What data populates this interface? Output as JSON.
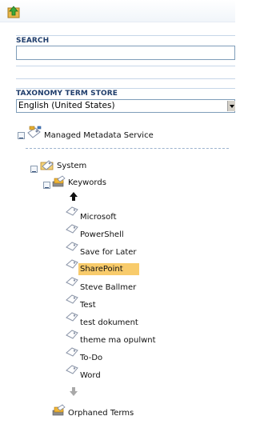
{
  "search": {
    "label": "SEARCH",
    "value": ""
  },
  "store": {
    "label": "TAXONOMY TERM STORE",
    "selected_language": "English (United States)"
  },
  "tree": {
    "service": "Managed Metadata Service",
    "group": "System",
    "term_set": "Keywords",
    "terms": [
      "Microsoft",
      "PowerShell",
      "Save for Later",
      "SharePoint",
      "Steve Ballmer",
      "Test",
      "test dokument",
      "theme ma opulwnt",
      "To-Do",
      "Word"
    ],
    "selected_term": "SharePoint",
    "orphaned": "Orphaned Terms"
  },
  "colors": {
    "accent": "#1f3d6b",
    "highlight": "#f8cb6b"
  }
}
